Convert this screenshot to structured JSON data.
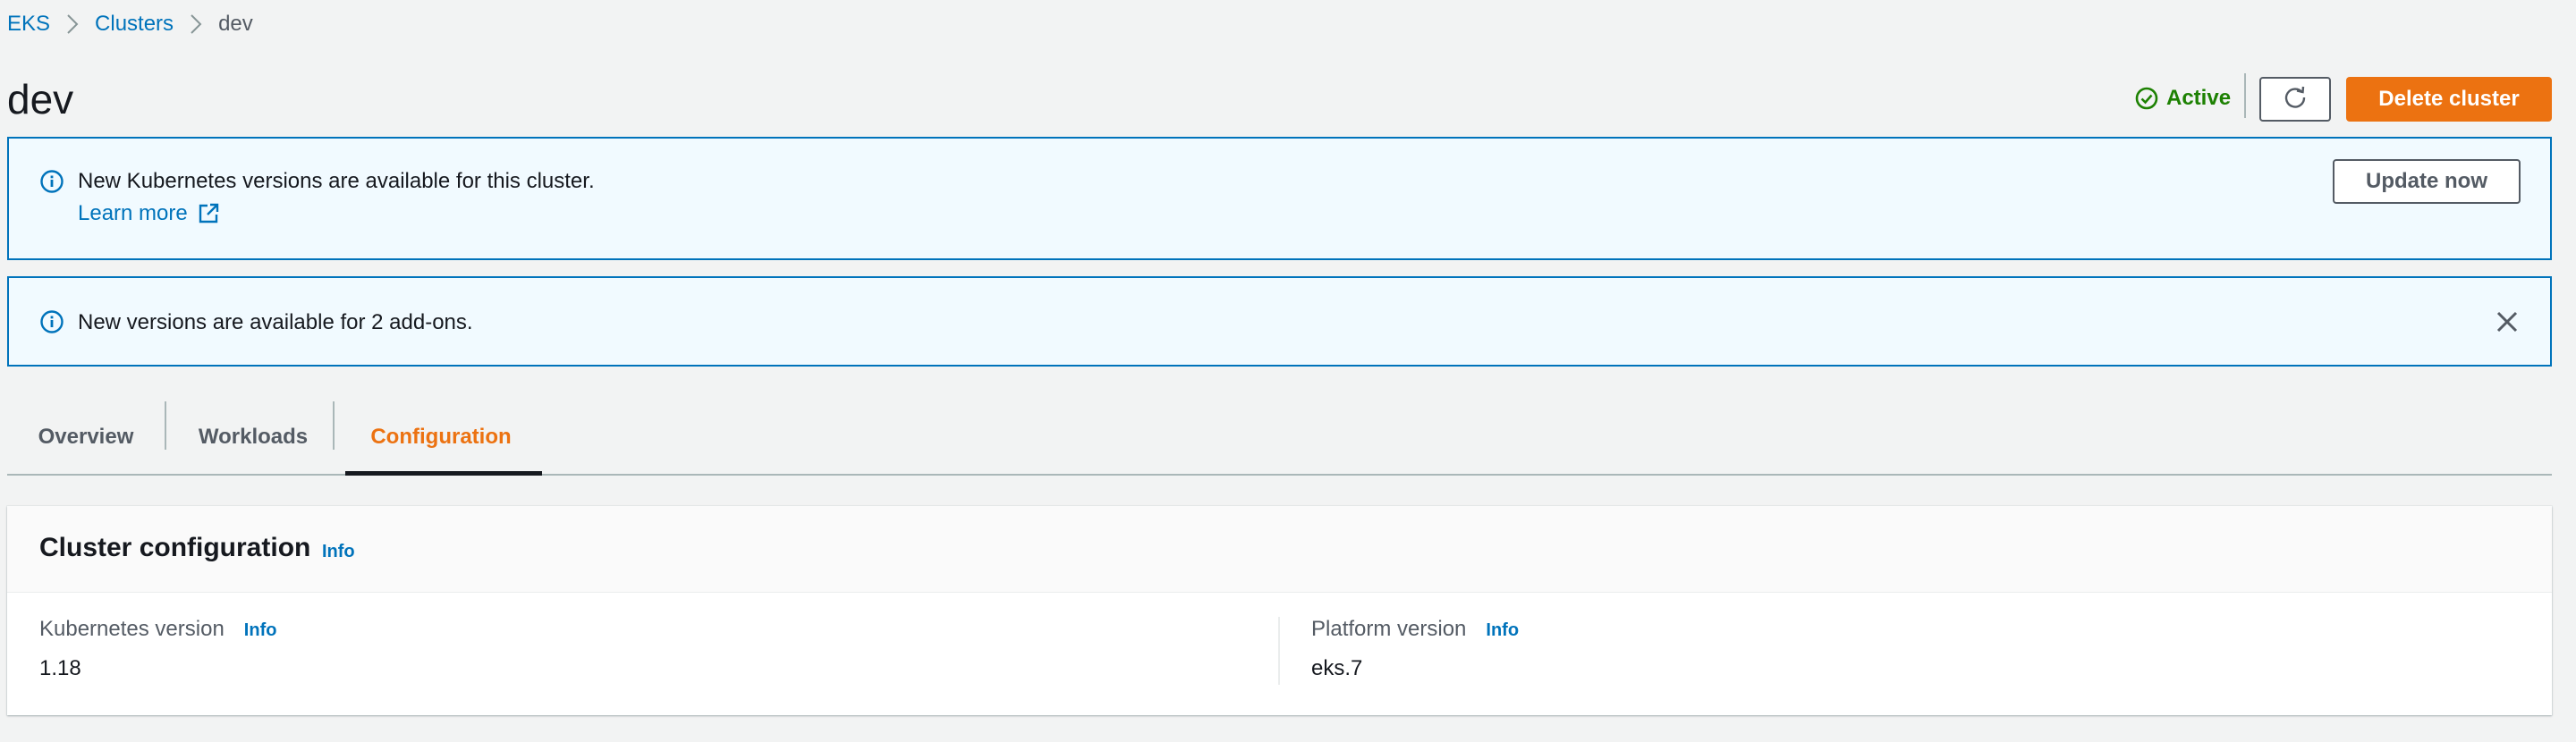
{
  "breadcrumb": {
    "items": [
      "EKS",
      "Clusters"
    ],
    "current": "dev"
  },
  "header": {
    "title": "dev",
    "status": "Active",
    "delete_label": "Delete cluster"
  },
  "alerts": [
    {
      "message": "New Kubernetes versions are available for this cluster.",
      "link_label": "Learn more",
      "action_label": "Update now"
    },
    {
      "message": "New versions are available for 2 add-ons."
    }
  ],
  "tabs": [
    {
      "label": "Overview",
      "active": false
    },
    {
      "label": "Workloads",
      "active": false
    },
    {
      "label": "Configuration",
      "active": true
    }
  ],
  "panel": {
    "title": "Cluster configuration",
    "info_label": "Info",
    "fields": [
      {
        "label": "Kubernetes version",
        "info_label": "Info",
        "value": "1.18"
      },
      {
        "label": "Platform version",
        "info_label": "Info",
        "value": "eks.7"
      }
    ]
  },
  "colors": {
    "link": "#0073bb",
    "primary": "#ec7211",
    "success": "#1d8102",
    "info_bg": "#f1faff",
    "page_bg": "#f2f3f3"
  },
  "icons": {
    "status": "check-circle-icon",
    "refresh": "refresh-icon",
    "info": "info-circle-icon",
    "external": "external-link-icon",
    "dismiss": "close-icon",
    "separator": "chevron-right-icon"
  }
}
